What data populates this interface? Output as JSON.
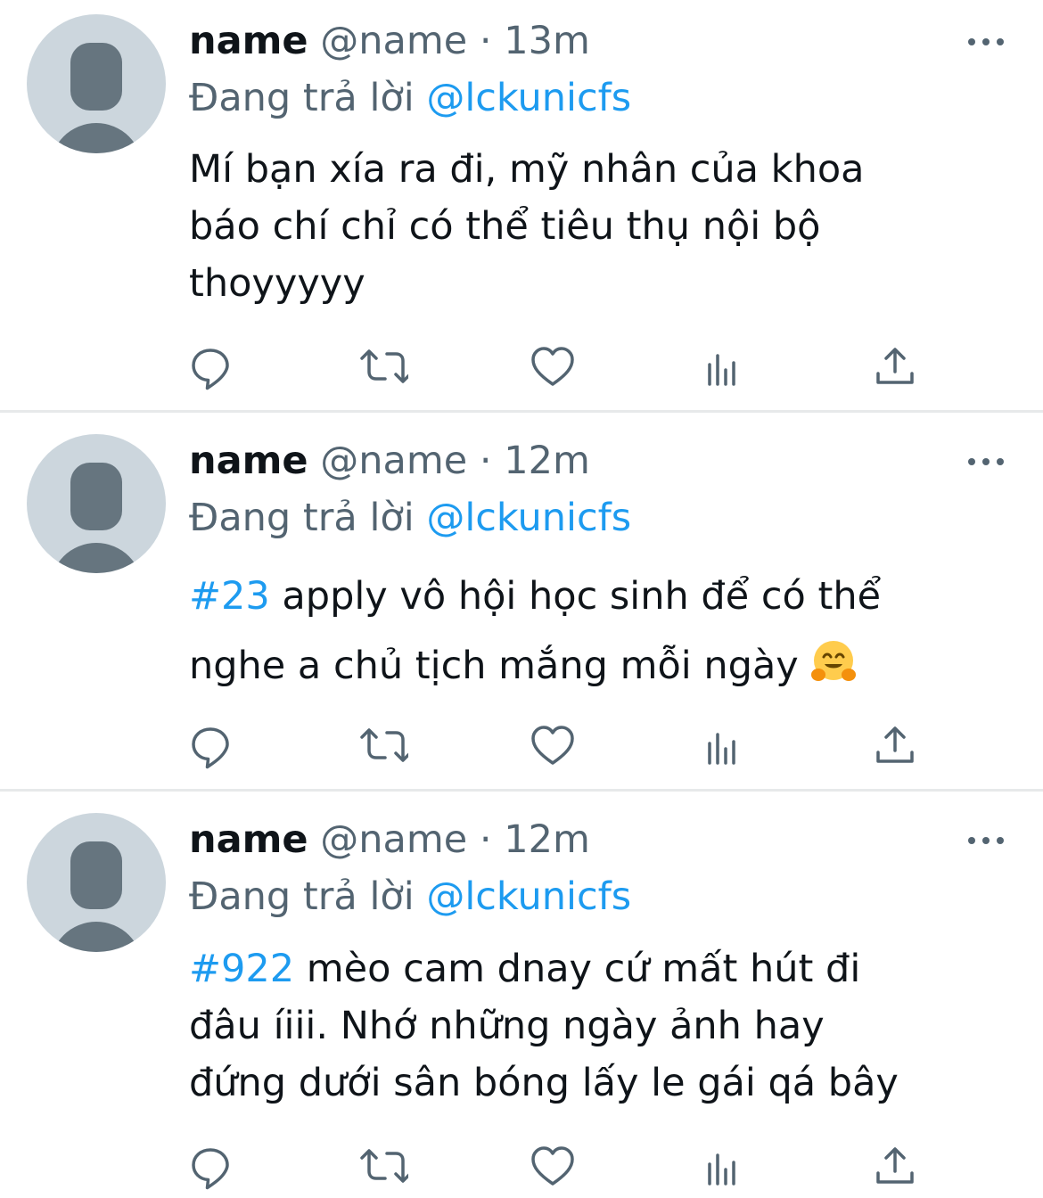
{
  "tweets": [
    {
      "display_name": "name",
      "handle": "@name",
      "separator": "·",
      "time": "13m",
      "reply_prefix": "Đang trả lời",
      "reply_to": "@lckunicfs",
      "hashtag": "",
      "lines": [
        "Mí bạn xía ra đi, mỹ nhân của khoa",
        "báo chí chỉ có thể tiêu thụ nội bộ",
        "thoyyyyy"
      ]
    },
    {
      "display_name": "name",
      "handle": "@name",
      "separator": "·",
      "time": "12m",
      "reply_prefix": "Đang trả lời",
      "reply_to": "@lckunicfs",
      "hashtag": "#23",
      "lines": [
        " apply vô hội học sinh để có thể",
        "nghe a chủ tịch mắng mỗi ngày "
      ],
      "trailing_emoji": "hugging-face-emoji"
    },
    {
      "display_name": "name",
      "handle": "@name",
      "separator": "·",
      "time": "12m",
      "reply_prefix": "Đang trả lời",
      "reply_to": "@lckunicfs",
      "hashtag": "#922",
      "lines": [
        " mèo cam dnay cứ mất hút đi",
        "đâu íiii. Nhớ những ngày ảnh hay",
        "đứng dưới sân bóng lấy le gái qá bây"
      ]
    }
  ],
  "icons": {
    "reply": "reply-icon",
    "retweet": "retweet-icon",
    "like": "like-icon",
    "analytics": "analytics-icon",
    "share": "share-icon",
    "more": "more-icon"
  },
  "colors": {
    "link": "#1d9bf0",
    "secondary": "#536471",
    "text": "#0f1419",
    "divider": "#e7e9ea",
    "avatar_bg": "#ccd6dd",
    "avatar_fg": "#66757f"
  }
}
